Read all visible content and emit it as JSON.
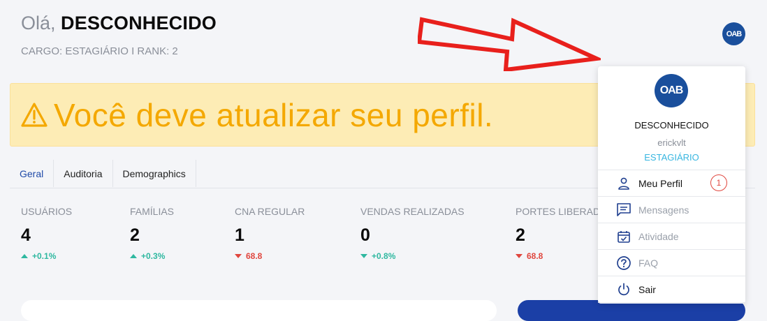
{
  "header": {
    "greeting_prefix": "Olá,",
    "user_name": "DESCONHECIDO",
    "role_line": "CARGO: ESTAGIÁRIO I RANK: 2",
    "avatar_logo": "OAB"
  },
  "warning": {
    "icon": "warning-triangle-icon",
    "text": "Você deve atualizar seu perfil.",
    "color": "#f4a800",
    "background": "#fdecb5"
  },
  "tabs": [
    {
      "label": "Geral",
      "active": true
    },
    {
      "label": "Auditoria",
      "active": false
    },
    {
      "label": "Demographics",
      "active": false
    }
  ],
  "stats": [
    {
      "label": "USUÁRIOS",
      "value": "4",
      "change": "+0.1%",
      "direction": "up"
    },
    {
      "label": "FAMÍLIAS",
      "value": "2",
      "change": "+0.3%",
      "direction": "up"
    },
    {
      "label": "CNA REGULAR",
      "value": "1",
      "change": "68.8",
      "direction": "down"
    },
    {
      "label": "VENDAS REALIZADAS",
      "value": "0",
      "change": "+0.8%",
      "direction": "up-down"
    },
    {
      "label": "PORTES LIBERADOS",
      "value": "2",
      "change": "68.8",
      "direction": "down"
    }
  ],
  "dropdown": {
    "avatar_logo": "OAB",
    "name": "DESCONHECIDO",
    "username": "erickvlt",
    "role": "ESTAGIÁRIO",
    "items": [
      {
        "label": "Meu Perfil",
        "icon": "person-icon",
        "badge": "1",
        "disabled": false
      },
      {
        "label": "Mensagens",
        "icon": "message-icon",
        "disabled": true
      },
      {
        "label": "Atividade",
        "icon": "calendar-check-icon",
        "disabled": true
      },
      {
        "label": "FAQ",
        "icon": "help-circle-icon",
        "disabled": true
      },
      {
        "label": "Sair",
        "icon": "power-icon",
        "disabled": false
      }
    ]
  },
  "colors": {
    "accent_blue": "#1f4aa8",
    "positive": "#2fb8a0",
    "negative": "#e0463e",
    "arrow_red": "#e8201c"
  }
}
